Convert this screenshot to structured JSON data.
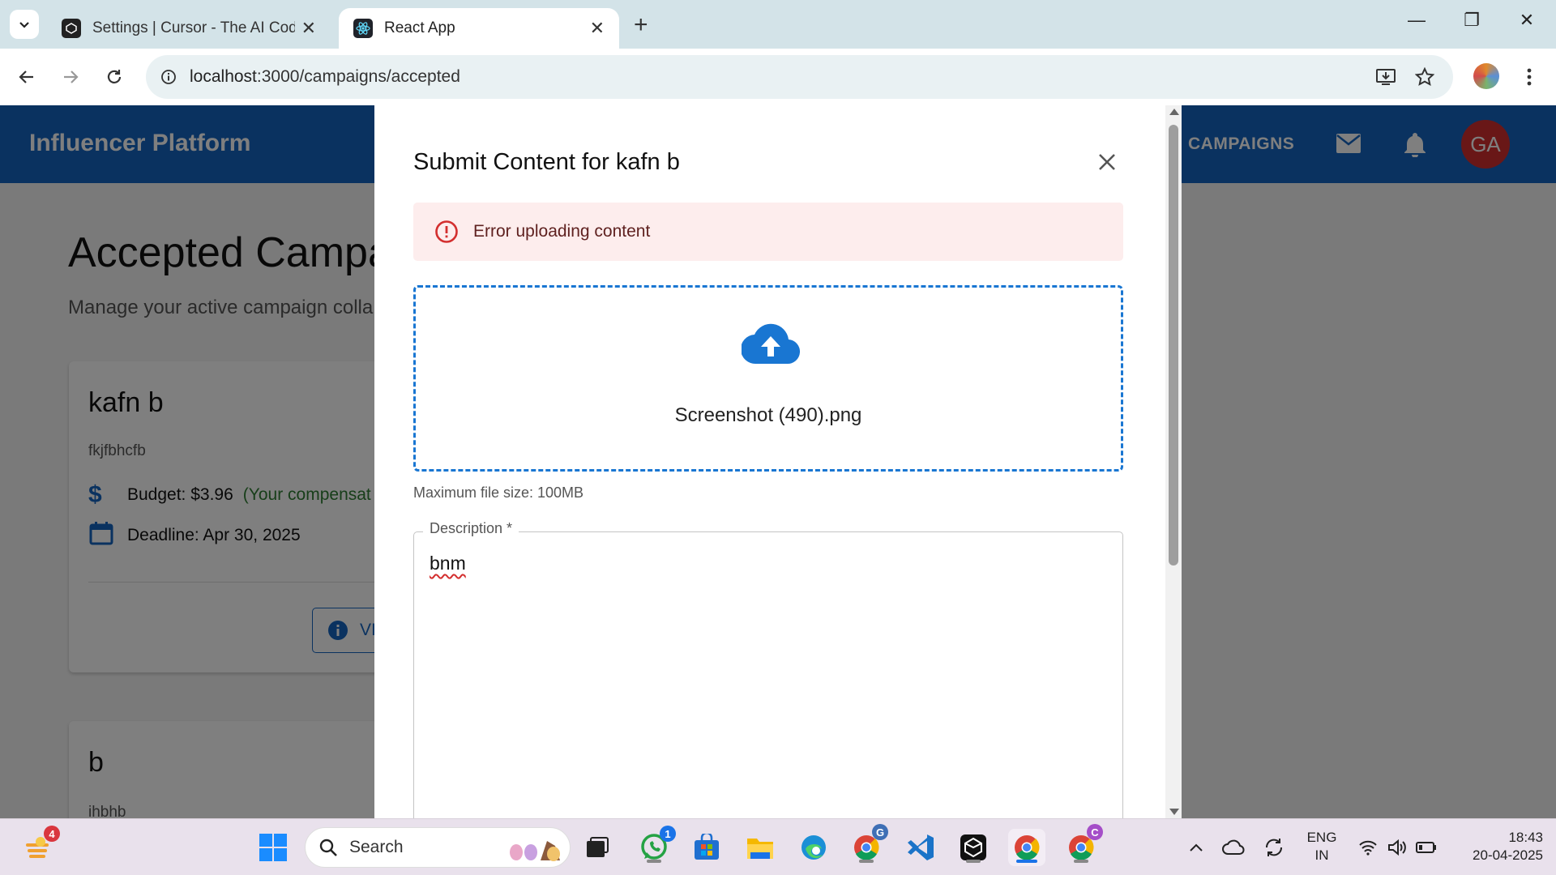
{
  "browser": {
    "tabs": [
      {
        "title": "Settings | Cursor - The AI Code",
        "active": false
      },
      {
        "title": "React App",
        "active": true
      }
    ],
    "url_host": "localhost",
    "url_rest": ":3000/campaigns/accepted"
  },
  "app": {
    "brand": "Influencer Platform",
    "nav_campaigns": "CAMPAIGNS",
    "avatar_initials": "GA",
    "page_title": "Accepted Campa",
    "page_subtitle": "Manage your active campaign colla",
    "cards": [
      {
        "title": "kafn b",
        "description": "fkjfbhcfb",
        "budget": "Budget: $3.96",
        "compensation": "(Your compensat",
        "deadline": "Deadline: Apr 30, 2025",
        "view_button": "VI"
      },
      {
        "title": "b",
        "description": "ihbhb"
      }
    ]
  },
  "dialog": {
    "title": "Submit Content for kafn b",
    "error": "Error uploading content",
    "file_name": "Screenshot (490).png",
    "max_size": "Maximum file size: 100MB",
    "description_label": "Description *",
    "description_value": "bnm"
  },
  "taskbar": {
    "widgets_badge": "4",
    "search_placeholder": "Search",
    "whatsapp_badge": "1",
    "language": "ENG",
    "region": "IN",
    "time": "18:43",
    "date": "20-04-2025"
  },
  "colors": {
    "appbar": "#1565c0",
    "avatar": "#d32f2f",
    "error_bg": "#fdeded",
    "dropzone_border": "#1976d2",
    "compensation": "#2e7d32"
  }
}
